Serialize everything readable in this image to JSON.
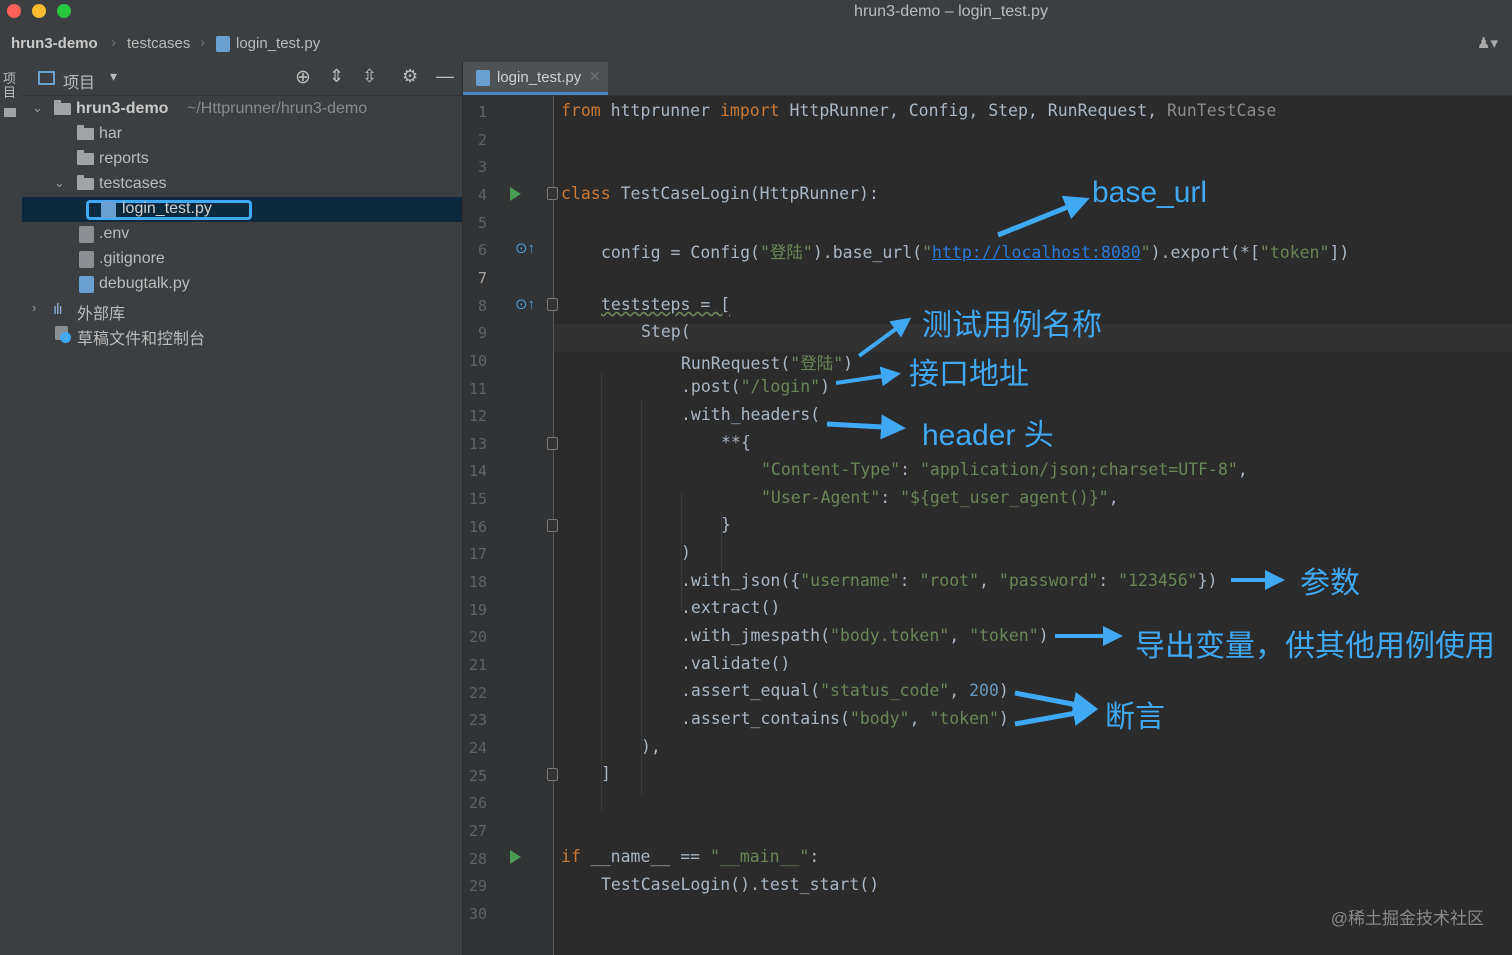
{
  "window": {
    "title": "hrun3-demo – login_test.py"
  },
  "breadcrumb": {
    "project": "hrun3-demo",
    "folder": "testcases",
    "file": "login_test.py"
  },
  "project_panel": {
    "stripe_label": "项目",
    "header_label": "项目",
    "tree": {
      "root_name": "hrun3-demo",
      "root_path": "~/Httprunner/hrun3-demo",
      "har": "har",
      "reports": "reports",
      "testcases": "testcases",
      "login_test": "login_test.py",
      "env": ".env",
      "gitignore": ".gitignore",
      "debugtalk": "debugtalk.py",
      "external": "外部库",
      "scratches": "草稿文件和控制台"
    }
  },
  "editor": {
    "tab_label": "login_test.py",
    "line_numbers": [
      "1",
      "2",
      "3",
      "4",
      "5",
      "6",
      "7",
      "8",
      "9",
      "10",
      "11",
      "12",
      "13",
      "14",
      "15",
      "16",
      "17",
      "18",
      "19",
      "20",
      "21",
      "22",
      "23",
      "24",
      "25",
      "26",
      "27",
      "28",
      "29",
      "30"
    ],
    "code": {
      "l1_from": "from",
      "l1_mod": " httprunner ",
      "l1_import": "import",
      "l1_names": " HttpRunner, Config, Step, RunRequest, ",
      "l1_dim": "RunTestCase",
      "l4_class": "class",
      "l4_rest": " TestCaseLogin(HttpRunner):",
      "l6_a": "config = Config(",
      "l6_s1": "\"登陆\"",
      "l6_b": ").base_url(",
      "l6_q1": "\"",
      "l6_url": "http://localhost:8080",
      "l6_q2": "\"",
      "l6_c": ").export(*[",
      "l6_s2": "\"token\"",
      "l6_d": "])",
      "l8": "teststeps = [",
      "l9": "Step(",
      "l10_a": "RunRequest(",
      "l10_s": "\"登陆\"",
      "l10_b": ")",
      "l11_a": ".post(",
      "l11_s": "\"/login\"",
      "l11_b": ")",
      "l12": ".with_headers(",
      "l13": "**{",
      "l14_k": "\"Content-Type\"",
      "l14_c": ": ",
      "l14_v": "\"application/json;charset=UTF-8\"",
      "l14_e": ",",
      "l15_k": "\"User-Agent\"",
      "l15_c": ": ",
      "l15_v": "\"${get_user_agent()}\"",
      "l15_e": ",",
      "l16": "}",
      "l17": ")",
      "l18_a": ".with_json({",
      "l18_k1": "\"username\"",
      "l18_c1": ": ",
      "l18_v1": "\"root\"",
      "l18_m": ", ",
      "l18_k2": "\"password\"",
      "l18_c2": ": ",
      "l18_v2": "\"123456\"",
      "l18_e": "})",
      "l19": ".extract()",
      "l20_a": ".with_jmespath(",
      "l20_s1": "\"body.token\"",
      "l20_m": ", ",
      "l20_s2": "\"token\"",
      "l20_e": ")",
      "l21": ".validate()",
      "l22_a": ".assert_equal(",
      "l22_s": "\"status_code\"",
      "l22_m": ", ",
      "l22_n": "200",
      "l22_e": ")",
      "l23_a": ".assert_contains(",
      "l23_s1": "\"body\"",
      "l23_m": ", ",
      "l23_s2": "\"token\"",
      "l23_e": ")",
      "l24": "),",
      "l25": "]",
      "l28_if": "if",
      "l28_a": " __name__ == ",
      "l28_s": "\"__main__\"",
      "l28_e": ":",
      "l29": "TestCaseLogin().test_start()"
    }
  },
  "annotations": {
    "base_url": "base_url",
    "name": "测试用例名称",
    "api": "接口地址",
    "header": "header 头",
    "params": "参数",
    "export": "导出变量，供其他用例使用",
    "assert": "断言"
  },
  "watermark": "@稀土掘金技术社区",
  "colors": {
    "accent": "#3fa9f5",
    "selection": "#0d293e",
    "keyword": "#cc7832",
    "string": "#6a8759"
  }
}
